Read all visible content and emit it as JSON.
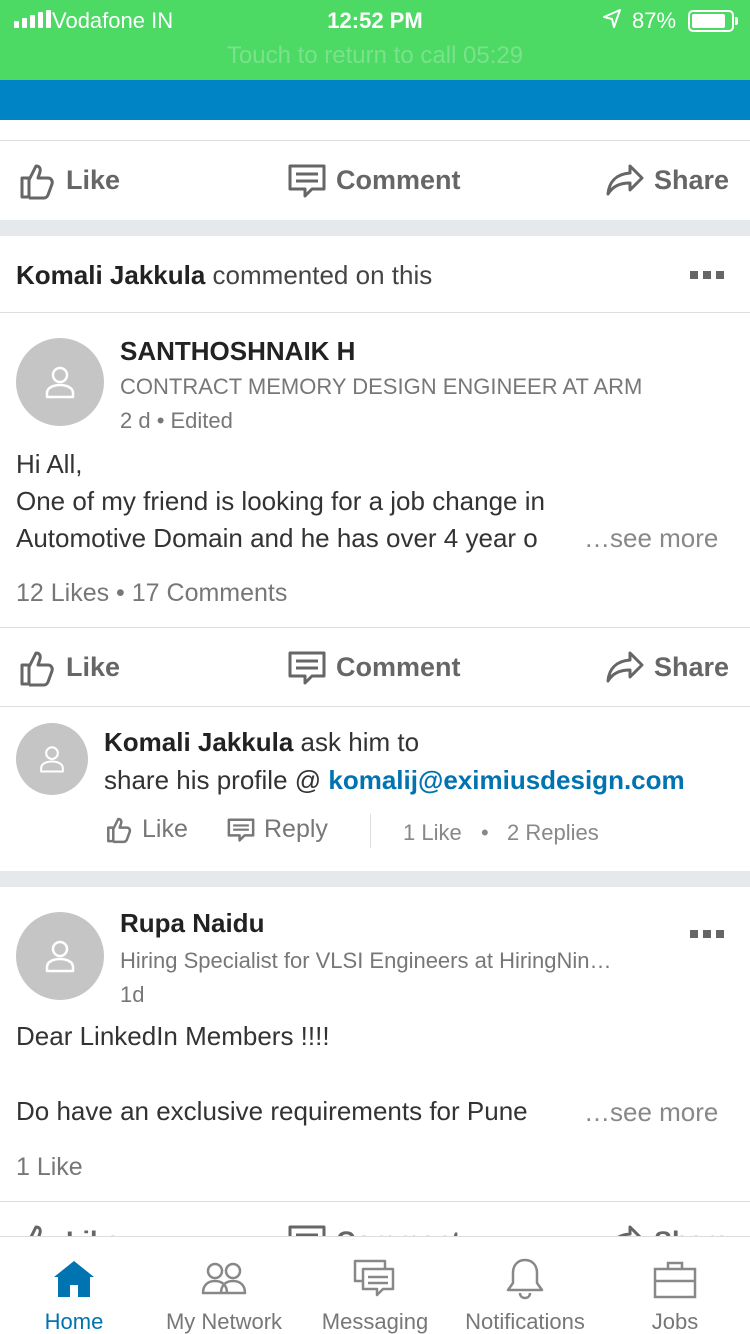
{
  "status_bar": {
    "carrier": "Vodafone IN",
    "time": "12:52 PM",
    "battery": "87%",
    "battery_level": 0.87,
    "call_banner": "Touch to return to call 05:29"
  },
  "actions": {
    "like": "Like",
    "comment": "Comment",
    "share": "Share"
  },
  "activity": {
    "actor": "Komali Jakkula",
    "verb": "commented on this"
  },
  "post1": {
    "author": "SANTHOSHNAIK H",
    "headline": "CONTRACT MEMORY DESIGN ENGINEER AT ARM",
    "meta": "2 d • Edited",
    "line1": "Hi All,",
    "line2": "One of my friend is looking for a job change in",
    "line3": "Automotive Domain and he has over 4 year o",
    "see_more": "…see more",
    "counts": "12 Likes • 17 Comments"
  },
  "comment": {
    "author": "Komali Jakkula",
    "text1": "ask him to",
    "text2": "share his profile @ ",
    "email": "komalij@eximiusdesign.com",
    "like": "Like",
    "reply": "Reply",
    "likes": "1 Like",
    "replies": "2 Replies"
  },
  "post2": {
    "author": "Rupa Naidu",
    "headline": "Hiring Specialist for VLSI Engineers at HiringNin…",
    "meta": "1d",
    "line1": "Dear LinkedIn Members !!!!",
    "line2": "Do have an exclusive requirements for Pune",
    "see_more": "…see more",
    "counts": "1 Like"
  },
  "tabs": {
    "home": "Home",
    "network": "My Network",
    "messaging": "Messaging",
    "notifications": "Notifications",
    "jobs": "Jobs"
  },
  "colors": {
    "status_bar": "#4cd964",
    "header": "#0084c6",
    "accent": "#0073b1"
  }
}
